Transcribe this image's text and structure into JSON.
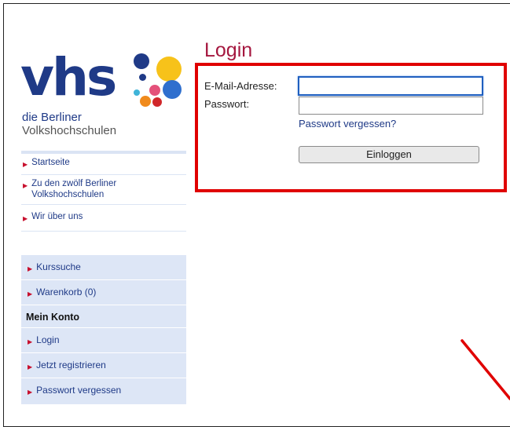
{
  "logo": {
    "brand": "vhs",
    "line1": "die Berliner",
    "line2": "Volkshochschulen"
  },
  "nav_primary": [
    {
      "label": "Startseite"
    },
    {
      "label": "Zu den zwölf Berliner Volkshochschulen"
    },
    {
      "label": "Wir über uns"
    }
  ],
  "nav_secondary": {
    "kurssuche": "Kurssuche",
    "warenkorb": "Warenkorb (0)",
    "mein_konto": "Mein Konto",
    "login": "Login",
    "registrieren": "Jetzt registrieren",
    "passwort_vergessen": "Passwort vergessen"
  },
  "login": {
    "title": "Login",
    "email_label": "E-Mail-Adresse:",
    "email_value": "",
    "password_label": "Passwort:",
    "password_value": "",
    "forgot_link": "Passwort vergessen?",
    "submit": "Einloggen"
  },
  "colors": {
    "brand_blue": "#1f3a87",
    "title_red": "#a5173f",
    "highlight_red": "#e00000",
    "nav_bg": "#dde6f6"
  }
}
